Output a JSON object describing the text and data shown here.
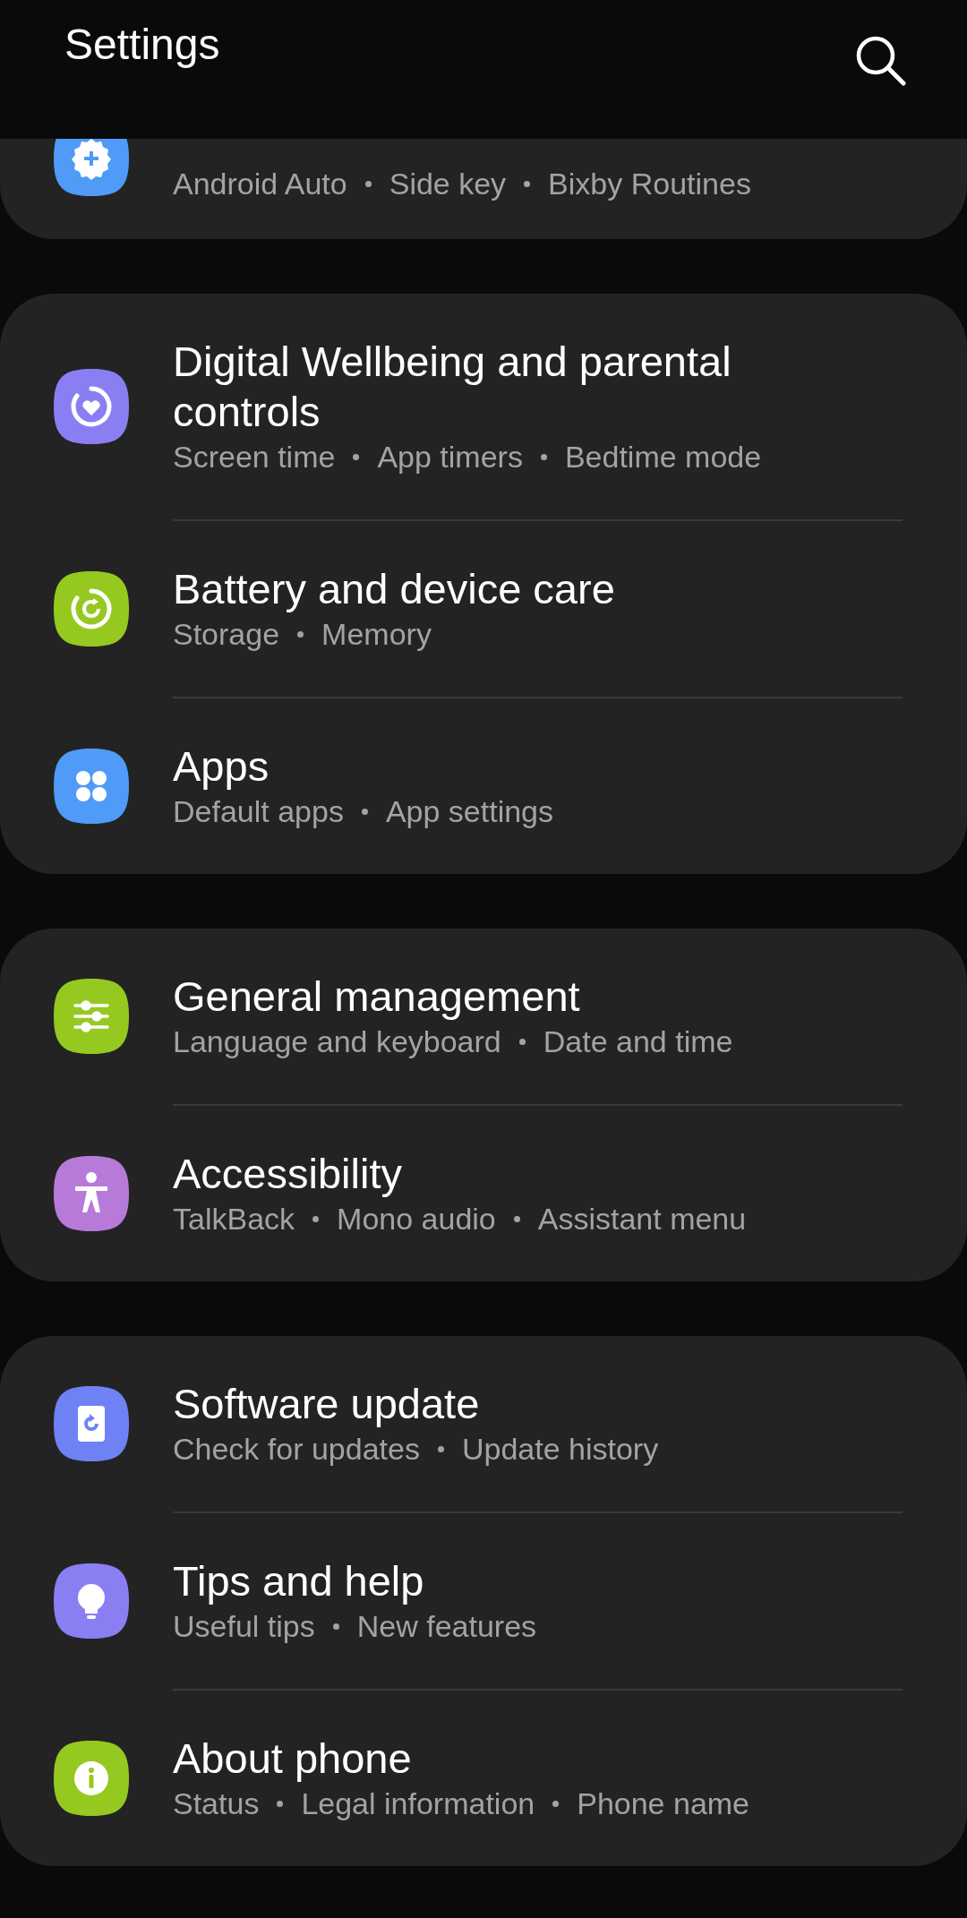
{
  "header": {
    "title": "Settings"
  },
  "groups": [
    {
      "cut_top": true,
      "items": [
        {
          "color": "#4f9bf7",
          "details": [
            "Android Auto",
            "Side key",
            "Bixby Routines"
          ]
        }
      ]
    },
    {
      "cut_top": false,
      "items": [
        {
          "title": "Digital Wellbeing and parental controls",
          "color": "#8a7ff2",
          "details": [
            "Screen time",
            "App timers",
            "Bedtime mode"
          ]
        },
        {
          "title": "Battery and device care",
          "color": "#96c920",
          "details": [
            "Storage",
            "Memory"
          ]
        },
        {
          "title": "Apps",
          "color": "#4f9bf7",
          "details": [
            "Default apps",
            "App settings"
          ]
        }
      ]
    },
    {
      "cut_top": false,
      "items": [
        {
          "title": "General management",
          "color": "#96c920",
          "details": [
            "Language and keyboard",
            "Date and time"
          ]
        },
        {
          "title": "Accessibility",
          "color": "#b77ad9",
          "details": [
            "TalkBack",
            "Mono audio",
            "Assistant menu"
          ]
        }
      ]
    },
    {
      "cut_top": false,
      "items": [
        {
          "title": "Software update",
          "color": "#6f82f5",
          "details": [
            "Check for updates",
            "Update history"
          ]
        },
        {
          "title": "Tips and help",
          "color": "#8a7ff2",
          "details": [
            "Useful tips",
            "New features"
          ]
        },
        {
          "title": "About phone",
          "color": "#96c920",
          "details": [
            "Status",
            "Legal information",
            "Phone name"
          ]
        }
      ]
    }
  ]
}
